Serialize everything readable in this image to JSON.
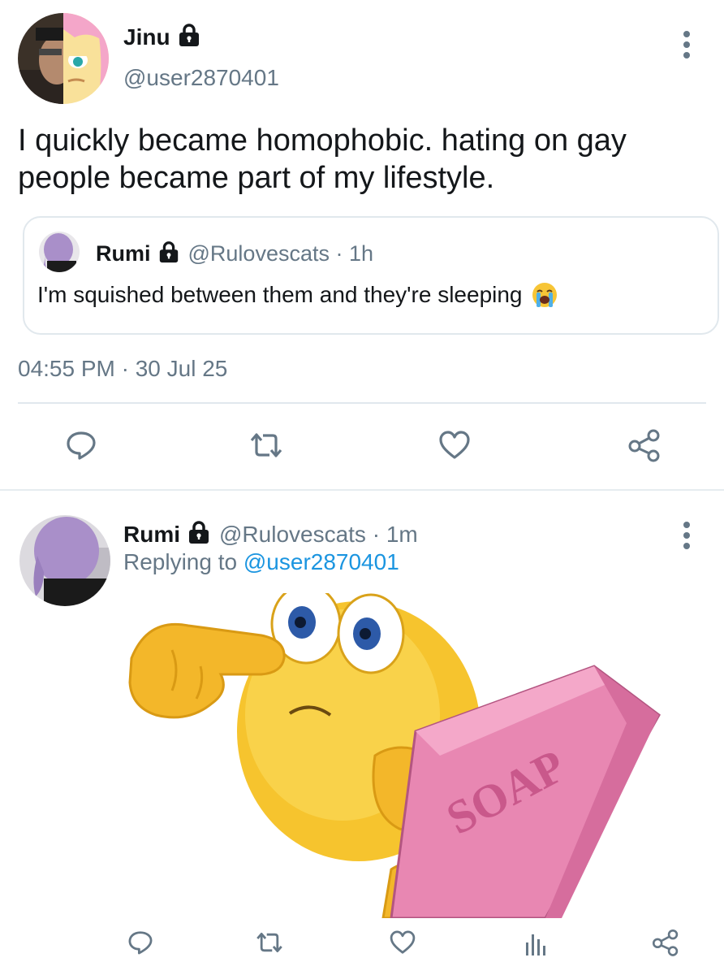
{
  "main_tweet": {
    "display_name": "Jinu",
    "handle": "@user2870401",
    "text": "I quickly became homophobic. hating on gay people became part of my lifestyle.",
    "timestamp": "04:55 PM · 30 Jul 25",
    "quoted": {
      "display_name": "Rumi",
      "handle_time": "@Rulovescats · 1h",
      "text": "I'm squished between them and they're sleeping"
    }
  },
  "reply_tweet": {
    "display_name": "Rumi",
    "handle_time": "@Rulovescats · 1m",
    "replying_prefix": "Replying to ",
    "replying_to": "@user2870401"
  },
  "colors": {
    "text_primary": "#14171a",
    "text_secondary": "#657786",
    "link": "#1b95e0",
    "border": "#e1e8ed",
    "icon": "#657786"
  },
  "icons": {
    "lock": "lock-icon",
    "more": "more-vertical-icon",
    "reply": "reply-icon",
    "retweet": "retweet-icon",
    "like": "heart-icon",
    "share": "share-icon",
    "analytics": "analytics-icon"
  }
}
